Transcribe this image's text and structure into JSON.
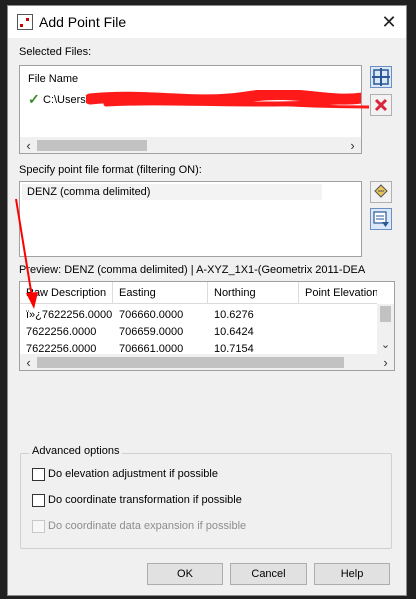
{
  "dialog": {
    "title": "Add Point File",
    "close_glyph": "✕"
  },
  "selected_files": {
    "label": "Selected Files:",
    "header": "File Name",
    "item": {
      "check_glyph": "✓",
      "text": "C:\\Users\\"
    },
    "add_icon": "add-file-icon",
    "remove_icon": "remove-file-icon"
  },
  "format": {
    "label": "Specify point file format (filtering ON):",
    "selected": "DENZ (comma delimited)",
    "edit_icon": "edit-format-icon",
    "manage_icon": "format-manager-icon"
  },
  "preview": {
    "label": "Preview: DENZ (comma delimited) | A-XYZ_1X1-(Geometrix 2011-DEA",
    "columns": [
      "Raw Description",
      "Easting",
      "Northing",
      "Point Elevation"
    ],
    "rows": [
      [
        "ï»¿7622256.0000",
        "706660.0000",
        "10.6276"
      ],
      [
        "7622256.0000",
        "706659.0000",
        "10.6424"
      ],
      [
        "7622256.0000",
        "706661.0000",
        "10.7154"
      ]
    ]
  },
  "advanced": {
    "title": "Advanced options",
    "options": [
      {
        "label": "Do elevation adjustment if possible",
        "checked": false,
        "enabled": true
      },
      {
        "label": "Do coordinate transformation if possible",
        "checked": false,
        "enabled": true
      },
      {
        "label": "Do coordinate data expansion if possible",
        "checked": false,
        "enabled": false
      }
    ]
  },
  "buttons": {
    "ok": "OK",
    "cancel": "Cancel",
    "help": "Help"
  },
  "scroll": {
    "left": "‹",
    "right": "›",
    "up": "⌃",
    "down": "⌄"
  },
  "colors": {
    "annotation_red": "#ff0000",
    "check_green": "#3a8a2c",
    "remove_red": "#d7263d",
    "accent_blue": "#2b5797"
  }
}
